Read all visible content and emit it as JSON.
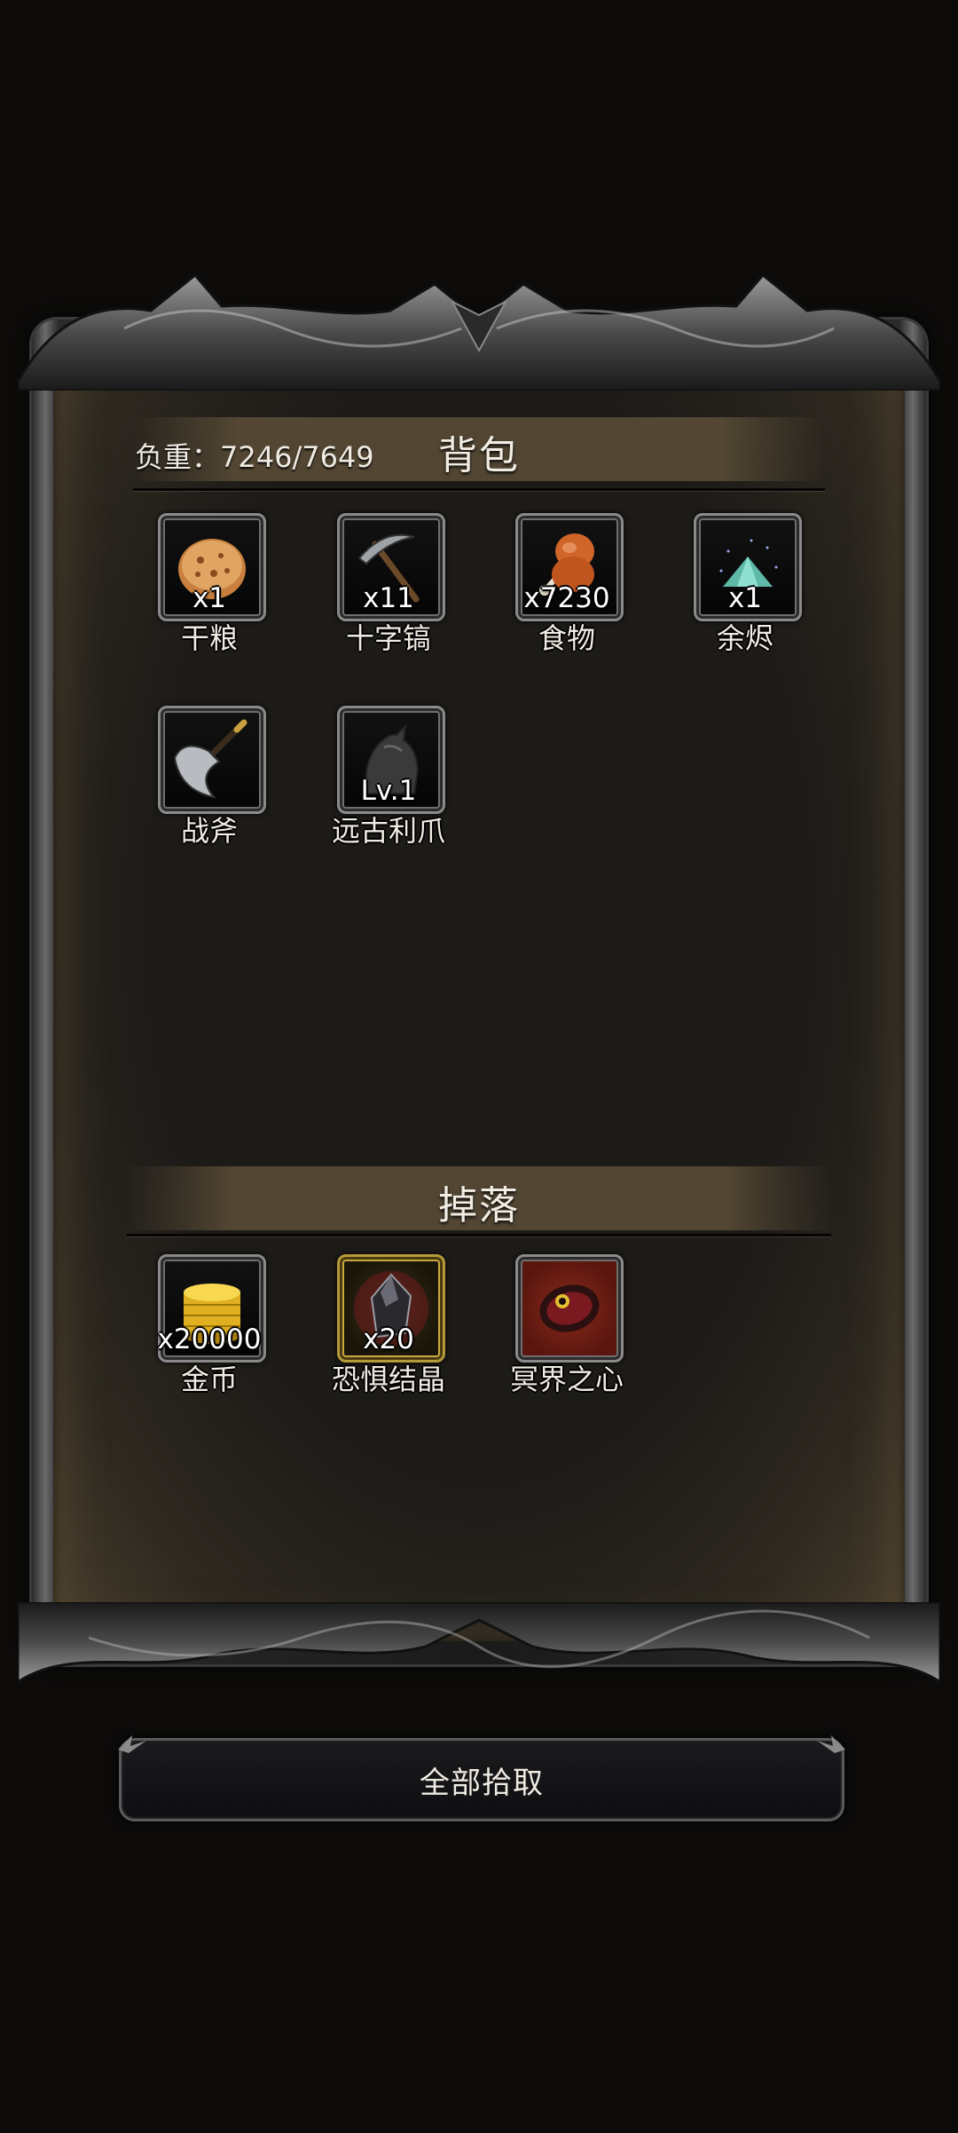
{
  "backpack": {
    "title": "背包",
    "weight_text": "负重：7246/7649",
    "items": [
      {
        "name": "干粮",
        "count": "x1",
        "icon": "dry-ration-icon"
      },
      {
        "name": "十字镐",
        "count": "x11",
        "icon": "pickaxe-icon"
      },
      {
        "name": "食物",
        "count": "x7230",
        "icon": "food-icon"
      },
      {
        "name": "余烬",
        "count": "x1",
        "icon": "ember-icon"
      },
      {
        "name": "战斧",
        "count": "",
        "icon": "battle-axe-icon"
      },
      {
        "name": "远古利爪",
        "count": "Lv.1",
        "icon": "ancient-claw-icon"
      }
    ]
  },
  "drops": {
    "title": "掉落",
    "items": [
      {
        "name": "金币",
        "count": "x20000",
        "icon": "gold-coin-icon"
      },
      {
        "name": "恐惧结晶",
        "count": "x20",
        "icon": "fear-crystal-icon"
      },
      {
        "name": "冥界之心",
        "count": "",
        "icon": "underworld-heart-icon"
      }
    ]
  },
  "actions": {
    "pick_all_label": "全部拾取"
  },
  "colors": {
    "panel_bg": "#1d1b18",
    "header_band": "#5c4e38",
    "text": "#f1ece3"
  }
}
